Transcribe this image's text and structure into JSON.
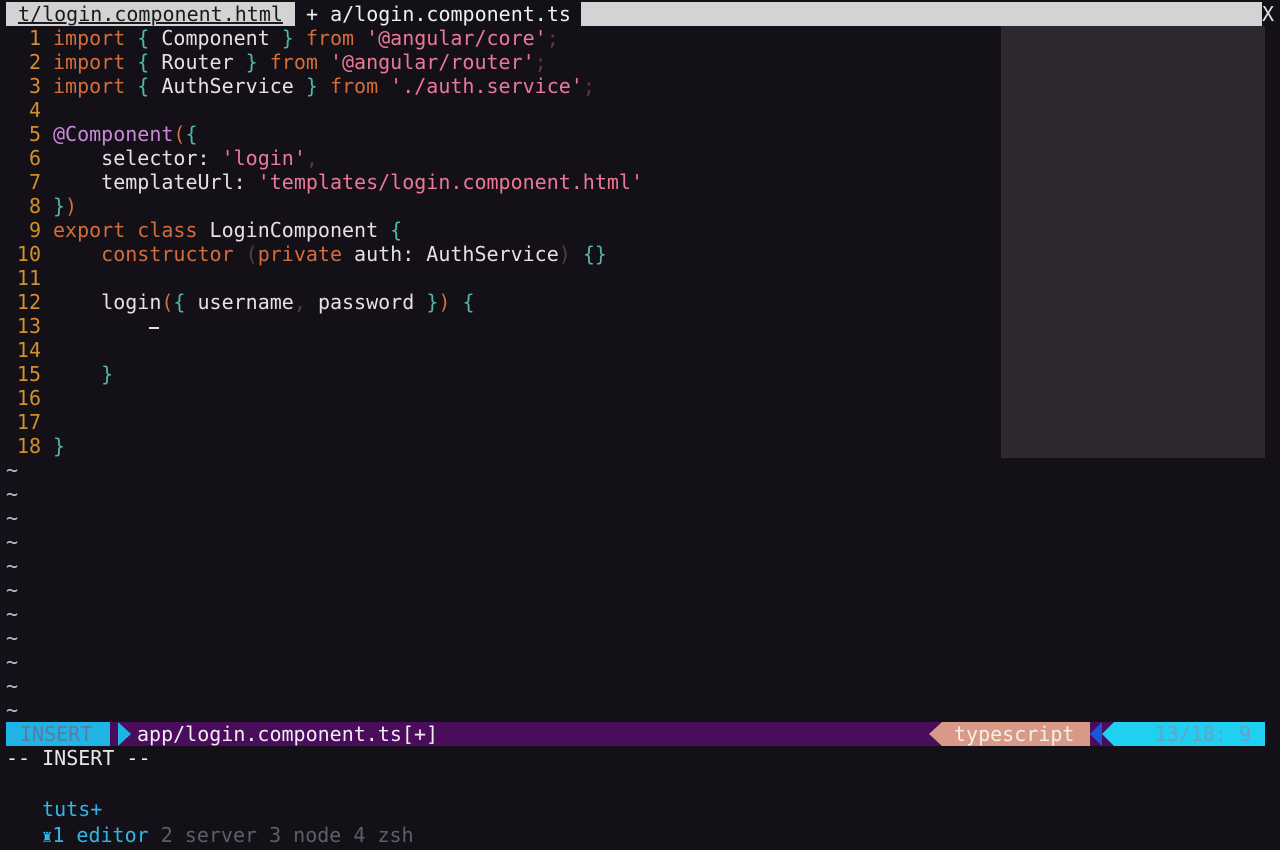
{
  "tabs": {
    "inactive_label": "t/login.component.html",
    "active_label": "+ a/login.component.ts",
    "close_label": "X"
  },
  "code_lines": [
    {
      "n": "1",
      "tokens": [
        [
          "kw",
          "import"
        ],
        [
          "pun",
          " { "
        ],
        [
          "id",
          "Component"
        ],
        [
          "pun",
          " } "
        ],
        [
          "kw",
          "from"
        ],
        [
          "id",
          " "
        ],
        [
          "str",
          "'@angular/core'"
        ],
        [
          "dim",
          ";"
        ]
      ]
    },
    {
      "n": "2",
      "tokens": [
        [
          "kw",
          "import"
        ],
        [
          "pun",
          " { "
        ],
        [
          "id",
          "Router"
        ],
        [
          "pun",
          " } "
        ],
        [
          "kw",
          "from"
        ],
        [
          "id",
          " "
        ],
        [
          "str",
          "'@angular/router'"
        ],
        [
          "dim",
          ";"
        ]
      ]
    },
    {
      "n": "3",
      "tokens": [
        [
          "kw",
          "import"
        ],
        [
          "pun",
          " { "
        ],
        [
          "id",
          "AuthService"
        ],
        [
          "pun",
          " } "
        ],
        [
          "kw",
          "from"
        ],
        [
          "id",
          " "
        ],
        [
          "str",
          "'./auth.service'"
        ],
        [
          "dim",
          ";"
        ]
      ]
    },
    {
      "n": "4",
      "tokens": []
    },
    {
      "n": "5",
      "tokens": [
        [
          "dec",
          "@Component"
        ],
        [
          "kw",
          "("
        ],
        [
          "pun",
          "{"
        ]
      ]
    },
    {
      "n": "6",
      "tokens": [
        [
          "id",
          "    selector: "
        ],
        [
          "str",
          "'login'"
        ],
        [
          "dim",
          ","
        ]
      ]
    },
    {
      "n": "7",
      "tokens": [
        [
          "id",
          "    templateUrl: "
        ],
        [
          "str",
          "'templates/login.component.html'"
        ]
      ]
    },
    {
      "n": "8",
      "tokens": [
        [
          "pun",
          "}"
        ],
        [
          "kw",
          ")"
        ]
      ]
    },
    {
      "n": "9",
      "tokens": [
        [
          "kw",
          "export class "
        ],
        [
          "id",
          "LoginComponent "
        ],
        [
          "pun",
          "{"
        ]
      ]
    },
    {
      "n": "10",
      "tokens": [
        [
          "id",
          "    "
        ],
        [
          "kw",
          "constructor "
        ],
        [
          "dim",
          "("
        ],
        [
          "kw",
          "private "
        ],
        [
          "id",
          "auth: AuthService"
        ],
        [
          "dim",
          ")"
        ],
        [
          "pun",
          " {}"
        ]
      ]
    },
    {
      "n": "11",
      "tokens": []
    },
    {
      "n": "12",
      "tokens": [
        [
          "id",
          "    login"
        ],
        [
          "kw",
          "("
        ],
        [
          "pun",
          "{ "
        ],
        [
          "id",
          "username"
        ],
        [
          "dim",
          ", "
        ],
        [
          "id",
          "password "
        ],
        [
          "pun",
          "}"
        ],
        [
          "kw",
          ")"
        ],
        [
          "pun",
          " {"
        ]
      ]
    },
    {
      "n": "13",
      "tokens": [
        [
          "id",
          "        "
        ],
        [
          "cursor",
          ""
        ]
      ]
    },
    {
      "n": "14",
      "tokens": []
    },
    {
      "n": "15",
      "tokens": [
        [
          "pun",
          "    }"
        ]
      ]
    },
    {
      "n": "16",
      "tokens": []
    },
    {
      "n": "17",
      "tokens": []
    },
    {
      "n": "18",
      "tokens": [
        [
          "pun",
          "}"
        ]
      ]
    }
  ],
  "empty_line_marker": "~",
  "empty_line_count": 11,
  "statusline": {
    "mode": "INSERT",
    "filename": "app/login.component.ts[+]",
    "filetype": "typescript",
    "position": "13/18:  9"
  },
  "cmdline": "-- INSERT --",
  "tmux": {
    "brand": "tuts+",
    "icon": "rook-icon",
    "windows": [
      {
        "label": "1 editor",
        "active": true
      },
      {
        "label": "2 server",
        "active": false
      },
      {
        "label": "3 node",
        "active": false
      },
      {
        "label": "4 zsh",
        "active": false
      }
    ]
  }
}
